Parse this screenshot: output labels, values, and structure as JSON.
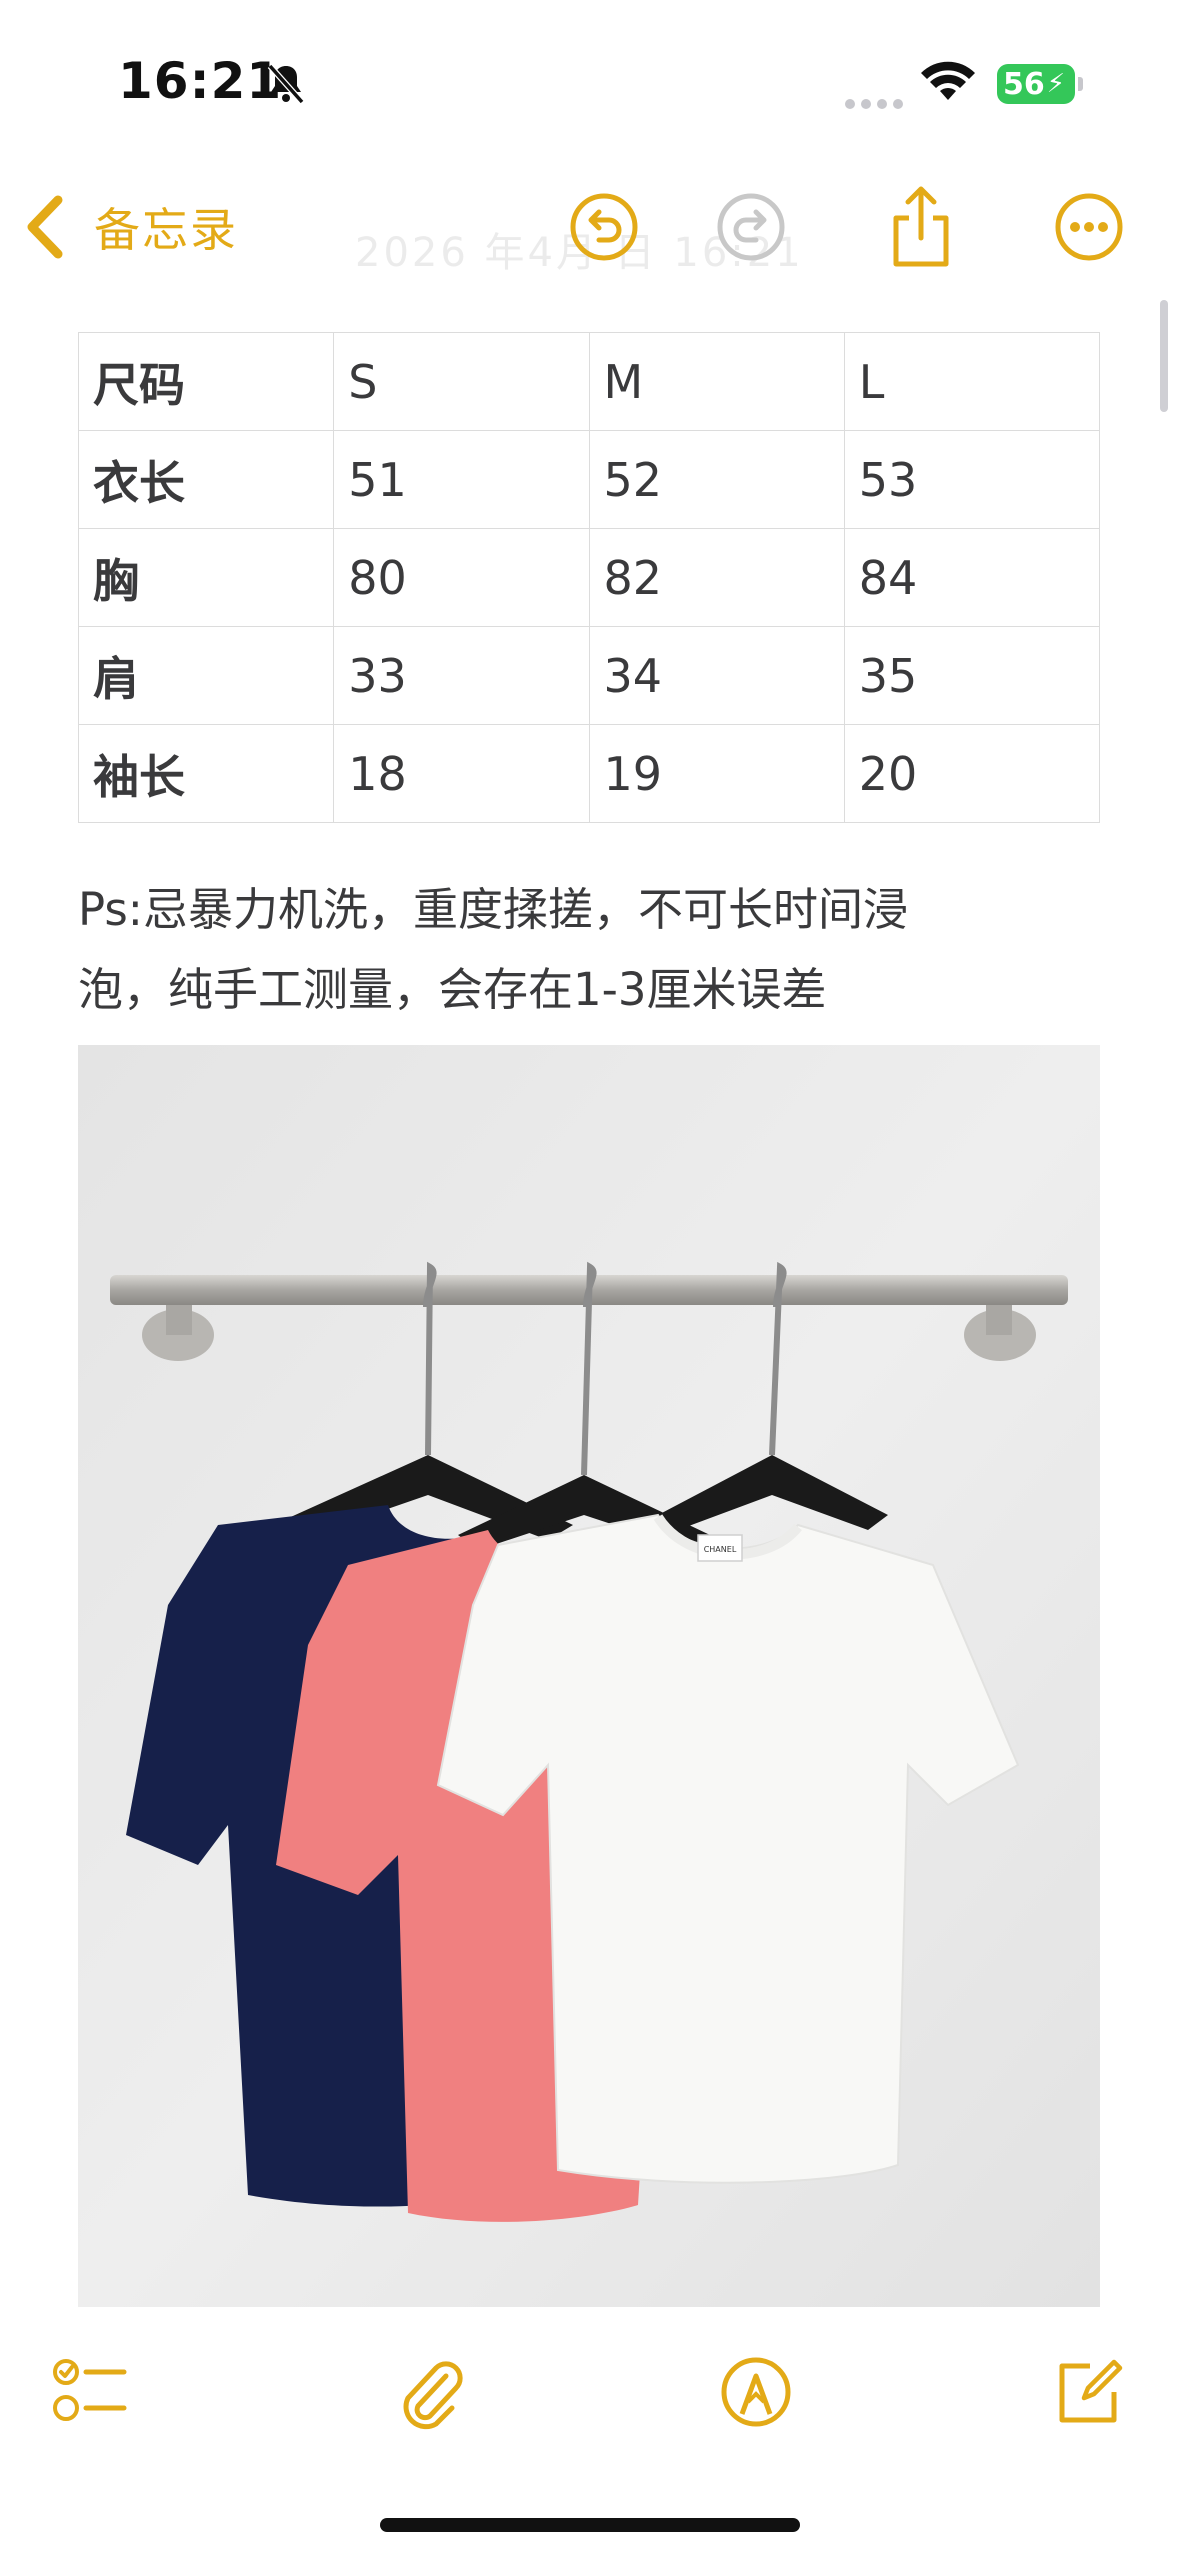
{
  "status_bar": {
    "time": "16:21",
    "battery": "56"
  },
  "nav": {
    "back_label": "备忘录",
    "faded_date": "2026 年4月 日 16:21"
  },
  "size_table": {
    "rows": [
      {
        "label": "尺码",
        "values": [
          "S",
          "M",
          "L"
        ]
      },
      {
        "label": "衣长",
        "values": [
          "51",
          "52",
          "53"
        ]
      },
      {
        "label": "胸",
        "values": [
          "80",
          "82",
          "84"
        ]
      },
      {
        "label": "肩",
        "values": [
          "33",
          "34",
          "35"
        ]
      },
      {
        "label": "袖长",
        "values": [
          "18",
          "19",
          "20"
        ]
      }
    ]
  },
  "note": {
    "line1": "Ps:忌暴力机洗，重度揉搓，不可长时间浸",
    "line2": "泡，纯手工测量，会存在1-3厘米误差"
  },
  "photo": {
    "tag_text": "CHANEL"
  },
  "colors": {
    "accent": "#e3aa17",
    "navy_shirt": "#16204a",
    "pink_shirt": "#f08080",
    "white_shirt": "#f8f8f6"
  }
}
